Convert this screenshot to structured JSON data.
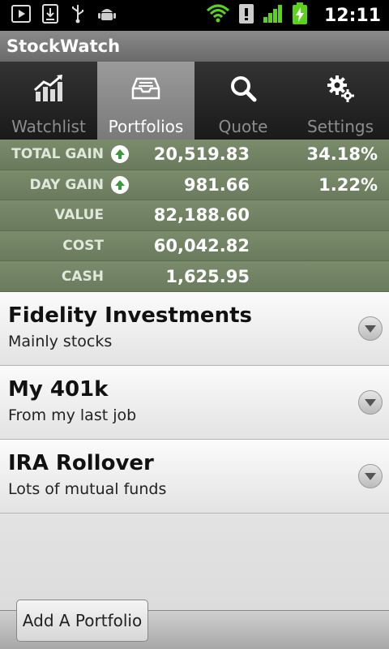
{
  "status_bar": {
    "time": "12:11",
    "icons": [
      "play-icon",
      "download-icon",
      "usb-icon",
      "android-icon",
      "wifi-icon",
      "alert-icon",
      "signal-icon",
      "battery-charging-icon"
    ]
  },
  "app": {
    "title": "StockWatch"
  },
  "tabs": [
    {
      "label": "Watchlist",
      "icon": "chart-icon",
      "active": false
    },
    {
      "label": "Portfolios",
      "icon": "inbox-icon",
      "active": true
    },
    {
      "label": "Quote",
      "icon": "search-icon",
      "active": false
    },
    {
      "label": "Settings",
      "icon": "gears-icon",
      "active": false
    }
  ],
  "summary": [
    {
      "label": "TOTAL GAIN",
      "value": "20,519.83",
      "percent": "34.18%",
      "arrow": "up"
    },
    {
      "label": "DAY GAIN",
      "value": "981.66",
      "percent": "1.22%",
      "arrow": "up"
    },
    {
      "label": "VALUE",
      "value": "82,188.60",
      "percent": ""
    },
    {
      "label": "COST",
      "value": "60,042.82",
      "percent": ""
    },
    {
      "label": "CASH",
      "value": "1,625.95",
      "percent": ""
    }
  ],
  "portfolios": [
    {
      "name": "Fidelity Investments",
      "description": "Mainly stocks"
    },
    {
      "name": "My 401k",
      "description": "From my last job"
    },
    {
      "name": "IRA Rollover",
      "description": "Lots of mutual funds"
    }
  ],
  "bottom": {
    "add_label": "Add A Portfolio"
  },
  "colors": {
    "summary_bg": "#6d7f60",
    "arrow_green": "#3a9a3a",
    "active_tab": "#8a8a8a"
  }
}
